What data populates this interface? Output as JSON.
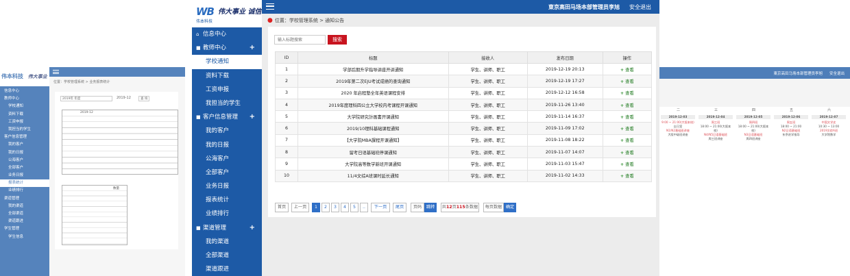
{
  "left_panel": {
    "logo": "伟本科技",
    "slogan": "伟大事业 诚信为本",
    "menu": [
      {
        "label": "信息中心",
        "group": true
      },
      {
        "label": "教师中心",
        "group": true
      },
      {
        "label": "学校通知"
      },
      {
        "label": "资料下载"
      },
      {
        "label": "工资申报"
      },
      {
        "label": "我担当的学生"
      },
      {
        "label": "客户信息管理",
        "group": true
      },
      {
        "label": "我的客户"
      },
      {
        "label": "我的日报"
      },
      {
        "label": "公海客户"
      },
      {
        "label": "全部客户"
      },
      {
        "label": "业务日报"
      },
      {
        "label": "报表统计",
        "active": true
      },
      {
        "label": "业绩排行"
      },
      {
        "label": "渠道管理",
        "group": true
      },
      {
        "label": "我的渠道"
      },
      {
        "label": "全部渠道"
      },
      {
        "label": "渠道跟进"
      },
      {
        "label": "学生管理",
        "group": true
      },
      {
        "label": "学生信息"
      }
    ],
    "breadcrumb": "位置：学校管理系统 > 业务报表统计",
    "filter_value": "2019年 年度",
    "month": "2019-12",
    "query_btn": "查 询",
    "table1_month": "2019-12",
    "table2_header": "数量"
  },
  "middle_panel": {
    "logo_mark_1": "WB",
    "company": "伟本科技",
    "slogan": "伟大事业 诚信为本",
    "user": "東京高田马场本部管理员李旭",
    "logout": "安全退出",
    "breadcrumb": "位置：学校管理系统 > 通知公告",
    "menu": [
      {
        "label": "信息中心",
        "group": true,
        "icon": "⌂"
      },
      {
        "label": "教师中心",
        "group": true,
        "icon": "■",
        "plus": "+"
      },
      {
        "label": "学校通知",
        "active": true
      },
      {
        "label": "资料下载"
      },
      {
        "label": "工资申报"
      },
      {
        "label": "我担当的学生"
      },
      {
        "label": "客户信息管理",
        "group": true,
        "icon": "■",
        "plus": "+"
      },
      {
        "label": "我的客户"
      },
      {
        "label": "我的日报"
      },
      {
        "label": "公海客户"
      },
      {
        "label": "全部客户"
      },
      {
        "label": "业务日报"
      },
      {
        "label": "报表统计"
      },
      {
        "label": "业绩排行"
      },
      {
        "label": "渠道管理",
        "group": true,
        "icon": "■",
        "plus": "+"
      },
      {
        "label": "我的渠道"
      },
      {
        "label": "全部渠道"
      },
      {
        "label": "渠道跟进"
      }
    ],
    "search": {
      "placeholder": "输入标题搜索",
      "button": "搜索"
    },
    "table": {
      "headers": [
        "ID",
        "标题",
        "接收人",
        "发布日期",
        "操作"
      ],
      "rows": [
        [
          "1",
          "学部后期升学指导讲座开讲通知",
          "学生、讲师、职工",
          "2019-12-19 20:13",
          "查看"
        ],
        [
          "2",
          "2019年第二次EJU考试成绩的查询通知",
          "学生、讲师、职工",
          "2019-12-19 17:27",
          "查看"
        ],
        [
          "3",
          "2020 年启程塾全年英语课程安排",
          "学生、讲师、职工",
          "2019-12-12 16:58",
          "查看"
        ],
        [
          "4",
          "2019年度理科四公立大学校内考课程开课通知",
          "学生、讲师、职工",
          "2019-11-26 13:40",
          "查看"
        ],
        [
          "5",
          "大学院研究計画書开课通知",
          "学生、讲师、职工",
          "2019-11-14 16:37",
          "查看"
        ],
        [
          "6",
          "2019/10理科基础课程通知",
          "学生、讲师、职工",
          "2019-11-09 17:02",
          "查看"
        ],
        [
          "7",
          "【大学院MBA課程开课通知】",
          "学生、讲师、职工",
          "2019-11-08 18:22",
          "查看"
        ],
        [
          "8",
          "留考日语基础班停课通知",
          "学生、讲师、职工",
          "2019-11-07 14:07",
          "查看"
        ],
        [
          "9",
          "大学院高等数学新班开课通知",
          "学生、讲师、职工",
          "2019-11-03 15:47",
          "查看"
        ],
        [
          "10",
          "11/4文综A班课时延长通知",
          "学生、讲师、职工",
          "2019-11-02 14:33",
          "查看"
        ]
      ]
    },
    "pager": {
      "first": "首页",
      "prev": "上一页",
      "pages": [
        "1",
        "2",
        "3",
        "4",
        "5",
        ".."
      ],
      "next": "下一页",
      "last": "尾页",
      "page_label": "页码",
      "go": "跳转",
      "total_pre": "共",
      "total_rec": "12",
      "total_mid": "页",
      "total_cnt": "115",
      "total_suf": "条数据",
      "per_page": "每页数据",
      "confirm": "确定"
    }
  },
  "right_panel": {
    "user": "東京高田马场本部管理员李旭",
    "logout": "安全退出",
    "weekdays": [
      "二",
      "三",
      "四",
      "五",
      "六"
    ],
    "columns": [
      {
        "date": "2019-12-03",
        "lines": [
          "9:00 ~ 21:00(大阪本校)",
          "自习室",
          "N1/N2基础班讲座",
          "大阪中级班讲座"
        ]
      },
      {
        "date": "2019-12-04",
        "lines": [
          "周三班",
          "18:00 ~ 21:00(大阪本校)",
          "N4/N5日语基础班",
          "周三班讲座"
        ]
      },
      {
        "date": "2019-12-05",
        "lines": [
          "周四班",
          "18:00 ~ 21:00(大阪本校)",
          "N3日语基础班",
          "周四班讲座"
        ]
      },
      {
        "date": "2019-12-06",
        "lines": [
          "周五班",
          "18:00 ~ 21:00",
          "N2日语基础班",
          "东京进学指导"
        ]
      },
      {
        "date": "2019-12-07",
        "lines": [
          "中国文学史",
          "10:30 ~ 13:00",
          "2019文综A班",
          "大学院数学"
        ]
      }
    ]
  }
}
